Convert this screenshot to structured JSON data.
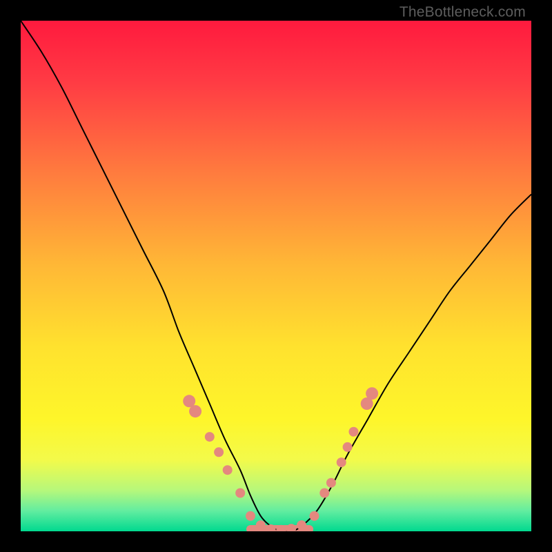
{
  "watermark": "TheBottleneck.com",
  "chart_data": {
    "type": "line",
    "title": "",
    "xlabel": "",
    "ylabel": "",
    "xlim": [
      0,
      100
    ],
    "ylim": [
      0,
      100
    ],
    "grid": false,
    "background_gradient": {
      "stops": [
        {
          "offset": 0.0,
          "color": "#ff1a3e"
        },
        {
          "offset": 0.12,
          "color": "#ff3b44"
        },
        {
          "offset": 0.3,
          "color": "#ff7c3e"
        },
        {
          "offset": 0.48,
          "color": "#ffb836"
        },
        {
          "offset": 0.64,
          "color": "#ffe22e"
        },
        {
          "offset": 0.78,
          "color": "#fef62a"
        },
        {
          "offset": 0.86,
          "color": "#f3fa4a"
        },
        {
          "offset": 0.92,
          "color": "#b6f87b"
        },
        {
          "offset": 0.96,
          "color": "#62eda0"
        },
        {
          "offset": 1.0,
          "color": "#00d98f"
        }
      ]
    },
    "series": [
      {
        "name": "bottleneck-curve",
        "color": "#000000",
        "width": 2,
        "x": [
          0,
          4,
          8,
          12,
          16,
          20,
          24,
          28,
          31,
          34,
          37,
          40,
          43,
          45,
          47,
          49,
          51,
          53,
          55,
          58,
          61,
          64,
          68,
          72,
          76,
          80,
          84,
          88,
          92,
          96,
          100
        ],
        "y": [
          100,
          94,
          87,
          79,
          71,
          63,
          55,
          47,
          39,
          32,
          25,
          18,
          12,
          7,
          3,
          1,
          0,
          0,
          1,
          4,
          9,
          15,
          22,
          29,
          35,
          41,
          47,
          52,
          57,
          62,
          66
        ]
      }
    ],
    "points": {
      "name": "data-dots",
      "color": "#e4887f",
      "radius_small": 7,
      "radius_large": 9,
      "items": [
        {
          "x": 33.0,
          "y": 25.5,
          "r": "large"
        },
        {
          "x": 34.2,
          "y": 23.5,
          "r": "large"
        },
        {
          "x": 37.0,
          "y": 18.5,
          "r": "small"
        },
        {
          "x": 38.8,
          "y": 15.5,
          "r": "small"
        },
        {
          "x": 40.5,
          "y": 12.0,
          "r": "small"
        },
        {
          "x": 43.0,
          "y": 7.5,
          "r": "small"
        },
        {
          "x": 45.0,
          "y": 3.0,
          "r": "small"
        },
        {
          "x": 47.0,
          "y": 1.2,
          "r": "small"
        },
        {
          "x": 49.0,
          "y": 0.4,
          "r": "small"
        },
        {
          "x": 51.0,
          "y": 0.3,
          "r": "small"
        },
        {
          "x": 53.0,
          "y": 0.5,
          "r": "small"
        },
        {
          "x": 55.0,
          "y": 1.2,
          "r": "small"
        },
        {
          "x": 57.5,
          "y": 3.0,
          "r": "small"
        },
        {
          "x": 59.5,
          "y": 7.5,
          "r": "small"
        },
        {
          "x": 60.8,
          "y": 9.5,
          "r": "small"
        },
        {
          "x": 62.8,
          "y": 13.5,
          "r": "small"
        },
        {
          "x": 64.0,
          "y": 16.5,
          "r": "small"
        },
        {
          "x": 65.2,
          "y": 19.5,
          "r": "small"
        },
        {
          "x": 67.8,
          "y": 25.0,
          "r": "large"
        },
        {
          "x": 68.8,
          "y": 27.0,
          "r": "large"
        }
      ]
    },
    "flat_segment": {
      "name": "valley-band",
      "color": "#e4887f",
      "x1": 45.0,
      "x2": 56.5,
      "y": 0.4,
      "thickness": 12
    }
  }
}
